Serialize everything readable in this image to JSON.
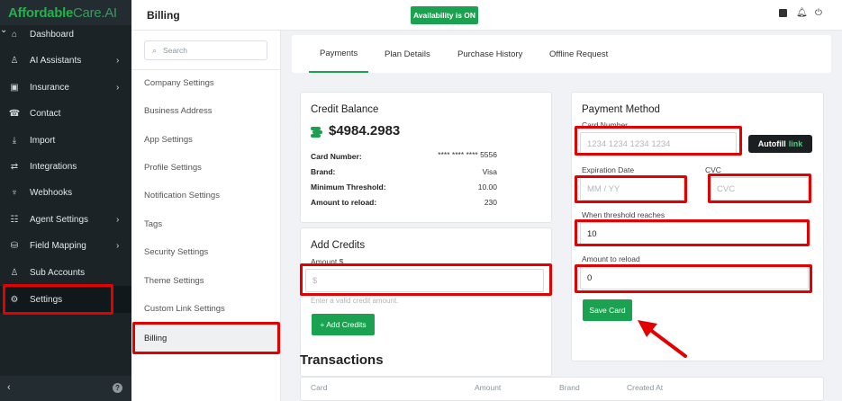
{
  "app": {
    "brand_main": "Affordable",
    "brand_light": "Care.AI",
    "brand_chevron": "⌄"
  },
  "sidebar": {
    "items": [
      {
        "label": "Dashboard",
        "icon": "⌂",
        "arrow": ""
      },
      {
        "label": "AI Assistants",
        "icon": "♙",
        "arrow": "›"
      },
      {
        "label": "Insurance",
        "icon": "▣",
        "arrow": "›"
      },
      {
        "label": "Contact",
        "icon": "☎",
        "arrow": ""
      },
      {
        "label": "Import",
        "icon": "⤓",
        "arrow": ""
      },
      {
        "label": "Integrations",
        "icon": "⇄",
        "arrow": ""
      },
      {
        "label": "Webhooks",
        "icon": "♆",
        "arrow": ""
      },
      {
        "label": "Agent Settings",
        "icon": "☷",
        "arrow": "›"
      },
      {
        "label": "Field Mapping",
        "icon": "⛁",
        "arrow": "›"
      },
      {
        "label": "Sub Accounts",
        "icon": "♙",
        "arrow": ""
      },
      {
        "label": "Settings",
        "icon": "⚙",
        "arrow": ""
      }
    ],
    "collapse_icon": "‹",
    "help_icon": "?"
  },
  "topbar": {
    "title": "Billing",
    "availability": "Availability is ON"
  },
  "submenu": {
    "search_placeholder": "Search",
    "items": [
      "Company Settings",
      "Business Address",
      "App Settings",
      "Profile Settings",
      "Notification Settings",
      "Tags",
      "Security Settings",
      "Theme Settings",
      "Custom Link Settings",
      "Billing"
    ]
  },
  "tabs": [
    "Payments",
    "Plan Details",
    "Purchase History",
    "Offline Request"
  ],
  "credit_balance": {
    "title": "Credit Balance",
    "amount": "$4984.2983",
    "rows": [
      {
        "label": "Card Number:",
        "value": "**** **** **** 5556"
      },
      {
        "label": "Brand:",
        "value": "Visa"
      },
      {
        "label": "Minimum Threshold:",
        "value": "10.00"
      },
      {
        "label": "Amount to reload:",
        "value": "230"
      }
    ]
  },
  "add_credits": {
    "title": "Add Credits",
    "amount_label": "Amount $",
    "amount_placeholder": "$",
    "hint": "Enter a valid credit amount.",
    "button": "+ Add Credits"
  },
  "payment_method": {
    "title": "Payment Method",
    "card_number_label": "Card Number",
    "card_number_placeholder": "1234 1234 1234 1234",
    "autofill_text": "Autofill",
    "autofill_link": "link",
    "expiration_label": "Expiration Date",
    "expiration_placeholder": "MM / YY",
    "cvc_label": "CVC",
    "cvc_placeholder": "CVC",
    "threshold_label": "When threshold reaches",
    "threshold_value": "10",
    "reload_label": "Amount to reload",
    "reload_value": "0",
    "save_button": "Save Card"
  },
  "transactions": {
    "title": "Transactions",
    "columns": [
      "Card",
      "Amount",
      "Brand",
      "Created At"
    ]
  },
  "colors": {
    "accent_green": "#1aa251",
    "highlight_red": "#e20000",
    "sidebar_bg": "#1b2326"
  }
}
